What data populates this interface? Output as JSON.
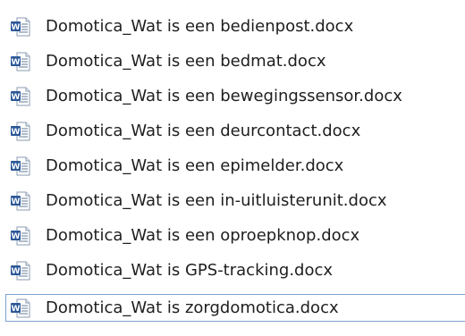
{
  "file_list": {
    "icon": "word-document-icon",
    "colors": {
      "word_blue": "#2b5797",
      "selection_border": "#7da2ce"
    },
    "files": [
      {
        "name": "Domotica_Wat is een bedienpost.docx",
        "selected": false
      },
      {
        "name": "Domotica_Wat is een bedmat.docx",
        "selected": false
      },
      {
        "name": "Domotica_Wat is een bewegingssensor.docx",
        "selected": false
      },
      {
        "name": "Domotica_Wat is een deurcontact.docx",
        "selected": false
      },
      {
        "name": "Domotica_Wat is een epimelder.docx",
        "selected": false
      },
      {
        "name": "Domotica_Wat is een in-uitluisterunit.docx",
        "selected": false
      },
      {
        "name": "Domotica_Wat is een oproepknop.docx",
        "selected": false
      },
      {
        "name": "Domotica_Wat is GPS-tracking.docx",
        "selected": false
      },
      {
        "name": "Domotica_Wat is zorgdomotica.docx",
        "selected": true
      }
    ]
  }
}
